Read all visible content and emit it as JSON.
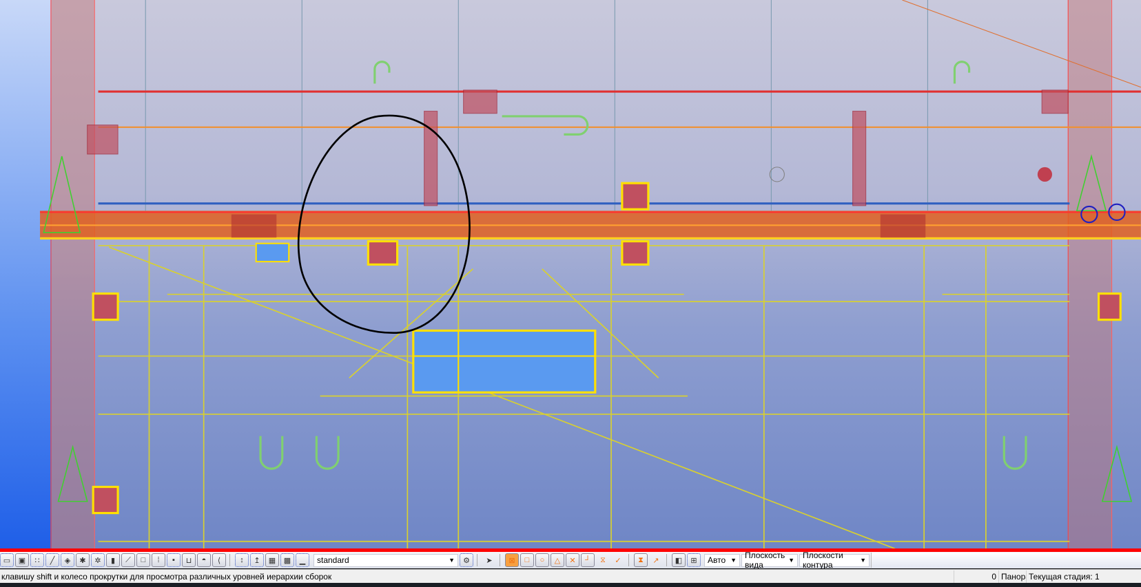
{
  "toolbar": {
    "icons": [
      "select-part-icon",
      "select-component-icon",
      "select-points-icon",
      "select-lines-icon",
      "select-surfaces-icon",
      "select-rebar-icon",
      "select-rebar-group-icon",
      "select-welds-icon",
      "select-cuts-icon",
      "select-views-icon",
      "select-grid-icon",
      "select-bolts-icon",
      "select-assembly-icon",
      "select-object-icon",
      "select-tool-icon",
      "snap-up-icon",
      "snap-down-icon",
      "snap-group-icon",
      "snap-mesh-icon",
      "snap-plane-icon"
    ],
    "filter_value": "standard",
    "snap_icons": [
      "snap-reference-icon",
      "snap-geometry-icon",
      "snap-center-icon",
      "snap-midpoint-icon",
      "snap-intersection-icon",
      "snap-perpendicular-icon",
      "snap-extension-icon",
      "snap-any-icon",
      "snap-nearest-icon",
      "snap-free-icon"
    ],
    "depth_value": "Авто",
    "plane_value": "Плоскость вида",
    "contour_value": "Плоскости контура"
  },
  "status": {
    "message": "клавишу shift и колесо прокрутки для просмотра различных уровней иерархии сборок",
    "count": "0",
    "mode": "Панорам",
    "phase": "Текущая стадия: 1"
  },
  "colors": {
    "accent_red": "#ff0000",
    "rebar_yellow": "#d8d030",
    "beam_orange": "#e86020"
  }
}
